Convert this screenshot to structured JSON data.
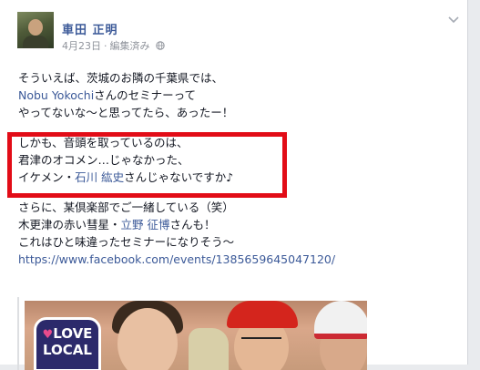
{
  "post": {
    "author": "車田 正明",
    "date": "4月23日",
    "separator": "·",
    "edited": "編集済み",
    "lines": {
      "l1": "そういえば、茨城のお隣の千葉県では、",
      "l2_link": "Nobu Yokochi",
      "l2_rest": "さんのセミナーって",
      "l3": "やってないな～と思ってたら、あったー！",
      "l4": "しかも、音頭を取っているのは、",
      "l5": "君津のオコメン…じゃなかった、",
      "l6_pre": "イケメン・",
      "l6_link": "石川 紘史",
      "l6_rest": "さんじゃないですか♪",
      "l7": "さらに、某倶楽部でご一緒している（笑）",
      "l8_pre": "木更津の赤い彗星・",
      "l8_link": "立野 征博",
      "l8_rest": "さんも！",
      "l9": "これはひと味違ったセミナーになりそう～",
      "url": "https://www.facebook.com/events/1385659645047120/"
    }
  },
  "preview": {
    "logo_line1": "LOVE",
    "logo_line2": "LOCAL",
    "logo_heart": "♥"
  },
  "colors": {
    "link": "#3b5998",
    "highlight": "#e20c17",
    "meta": "#90949c"
  },
  "icons": {
    "options": "chevron-down-icon",
    "privacy": "globe-icon"
  }
}
